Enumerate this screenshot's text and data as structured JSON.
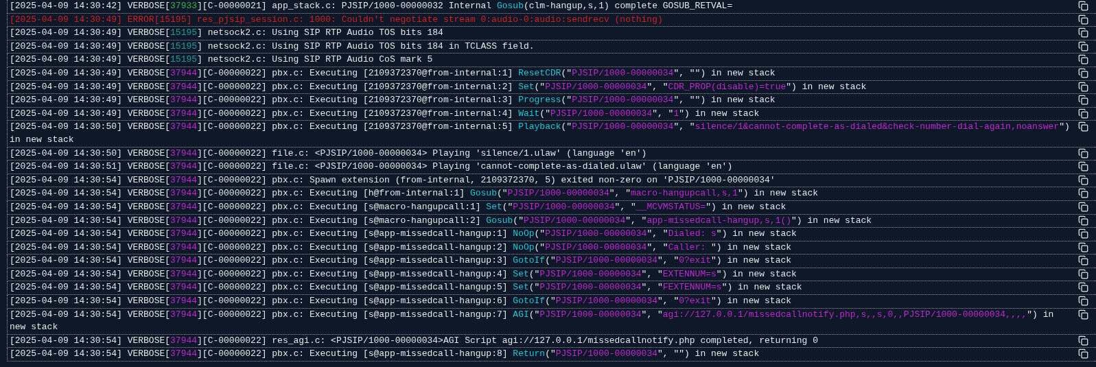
{
  "log_lines": [
    {
      "kind": "verbose",
      "parts": [
        {
          "kind": "text",
          "text": "[2025-04-09 14:30:42] VERBOSE["
        },
        {
          "kind": "pid",
          "text": "37933",
          "color": "#2fb344"
        },
        {
          "kind": "text",
          "text": "][C-00000021] app_stack.c: PJSIP/1000-00000032 Internal "
        },
        {
          "kind": "app",
          "text": "Gosub"
        },
        {
          "kind": "text",
          "text": "(clm-hangup,s,1) complete GOSUB_RETVAL="
        }
      ]
    },
    {
      "kind": "error",
      "parts": [
        {
          "kind": "text",
          "text": "[2025-04-09 14:30:49] ERROR[15195] res_pjsip_session.c: 1000: Couldn't negotiate stream 0:audio-0:audio:sendrecv (nothing)"
        }
      ]
    },
    {
      "kind": "verbose",
      "parts": [
        {
          "kind": "text",
          "text": "[2025-04-09 14:30:49] VERBOSE["
        },
        {
          "kind": "pid",
          "text": "15195",
          "color": "#17a09a"
        },
        {
          "kind": "text",
          "text": "] netsock2.c: Using SIP RTP Audio TOS bits 184"
        }
      ]
    },
    {
      "kind": "verbose",
      "parts": [
        {
          "kind": "text",
          "text": "[2025-04-09 14:30:49] VERBOSE["
        },
        {
          "kind": "pid",
          "text": "15195",
          "color": "#17a09a"
        },
        {
          "kind": "text",
          "text": "] netsock2.c: Using SIP RTP Audio TOS bits 184 in TCLASS field."
        }
      ]
    },
    {
      "kind": "verbose",
      "parts": [
        {
          "kind": "text",
          "text": "[2025-04-09 14:30:49] VERBOSE["
        },
        {
          "kind": "pid",
          "text": "15195",
          "color": "#17a09a"
        },
        {
          "kind": "text",
          "text": "] netsock2.c: Using SIP RTP Audio CoS mark 5"
        }
      ]
    },
    {
      "kind": "verbose",
      "parts": [
        {
          "kind": "text",
          "text": "[2025-04-09 14:30:49] VERBOSE["
        },
        {
          "kind": "pid",
          "text": "37944",
          "color": "#c026d3"
        },
        {
          "kind": "text",
          "text": "][C-00000022] pbx.c: Executing [2109372370@from-internal:1] "
        },
        {
          "kind": "app",
          "text": "ResetCDR"
        },
        {
          "kind": "text",
          "text": "(\""
        },
        {
          "kind": "arg",
          "text": "PJSIP/1000-00000034"
        },
        {
          "kind": "text",
          "text": "\", \"\") in new stack"
        }
      ]
    },
    {
      "kind": "verbose",
      "parts": [
        {
          "kind": "text",
          "text": "[2025-04-09 14:30:49] VERBOSE["
        },
        {
          "kind": "pid",
          "text": "37944",
          "color": "#c026d3"
        },
        {
          "kind": "text",
          "text": "][C-00000022] pbx.c: Executing [2109372370@from-internal:2] "
        },
        {
          "kind": "app",
          "text": "Set"
        },
        {
          "kind": "text",
          "text": "(\""
        },
        {
          "kind": "arg",
          "text": "PJSIP/1000-00000034"
        },
        {
          "kind": "text",
          "text": "\", \""
        },
        {
          "kind": "arg",
          "text": "CDR_PROP(disable)=true"
        },
        {
          "kind": "text",
          "text": "\") in new stack"
        }
      ]
    },
    {
      "kind": "verbose",
      "parts": [
        {
          "kind": "text",
          "text": "[2025-04-09 14:30:49] VERBOSE["
        },
        {
          "kind": "pid",
          "text": "37944",
          "color": "#c026d3"
        },
        {
          "kind": "text",
          "text": "][C-00000022] pbx.c: Executing [2109372370@from-internal:3] "
        },
        {
          "kind": "app",
          "text": "Progress"
        },
        {
          "kind": "text",
          "text": "(\""
        },
        {
          "kind": "arg",
          "text": "PJSIP/1000-00000034"
        },
        {
          "kind": "text",
          "text": "\", \"\") in new stack"
        }
      ]
    },
    {
      "kind": "verbose",
      "parts": [
        {
          "kind": "text",
          "text": "[2025-04-09 14:30:49] VERBOSE["
        },
        {
          "kind": "pid",
          "text": "37944",
          "color": "#c026d3"
        },
        {
          "kind": "text",
          "text": "][C-00000022] pbx.c: Executing [2109372370@from-internal:4] "
        },
        {
          "kind": "app",
          "text": "Wait"
        },
        {
          "kind": "text",
          "text": "(\""
        },
        {
          "kind": "arg",
          "text": "PJSIP/1000-00000034"
        },
        {
          "kind": "text",
          "text": "\", \""
        },
        {
          "kind": "arg",
          "text": "1"
        },
        {
          "kind": "text",
          "text": "\") in new stack"
        }
      ]
    },
    {
      "kind": "verbose",
      "parts": [
        {
          "kind": "text",
          "text": "[2025-04-09 14:30:50] VERBOSE["
        },
        {
          "kind": "pid",
          "text": "37944",
          "color": "#c026d3"
        },
        {
          "kind": "text",
          "text": "][C-00000022] pbx.c: Executing [2109372370@from-internal:5] "
        },
        {
          "kind": "app",
          "text": "Playback"
        },
        {
          "kind": "text",
          "text": "(\""
        },
        {
          "kind": "arg",
          "text": "PJSIP/1000-00000034"
        },
        {
          "kind": "text",
          "text": "\", \""
        },
        {
          "kind": "arg",
          "text": "silence/1&cannot-complete-as-dialed&check-number-dial-again,noanswer"
        },
        {
          "kind": "text",
          "text": "\") in new stack"
        }
      ]
    },
    {
      "kind": "verbose",
      "parts": [
        {
          "kind": "text",
          "text": "[2025-04-09 14:30:50] VERBOSE["
        },
        {
          "kind": "pid",
          "text": "37944",
          "color": "#c026d3"
        },
        {
          "kind": "text",
          "text": "][C-00000022] file.c: <PJSIP/1000-00000034> Playing 'silence/1.ulaw' (language 'en')"
        }
      ]
    },
    {
      "kind": "verbose",
      "parts": [
        {
          "kind": "text",
          "text": "[2025-04-09 14:30:51] VERBOSE["
        },
        {
          "kind": "pid",
          "text": "37944",
          "color": "#c026d3"
        },
        {
          "kind": "text",
          "text": "][C-00000022] file.c: <PJSIP/1000-00000034> Playing 'cannot-complete-as-dialed.ulaw' (language 'en')"
        }
      ]
    },
    {
      "kind": "verbose",
      "parts": [
        {
          "kind": "text",
          "text": "[2025-04-09 14:30:54] VERBOSE["
        },
        {
          "kind": "pid",
          "text": "37944",
          "color": "#c026d3"
        },
        {
          "kind": "text",
          "text": "][C-00000022] pbx.c: Spawn extension (from-internal, 2109372370, 5) exited non-zero on 'PJSIP/1000-00000034'"
        }
      ]
    },
    {
      "kind": "verbose",
      "parts": [
        {
          "kind": "text",
          "text": "[2025-04-09 14:30:54] VERBOSE["
        },
        {
          "kind": "pid",
          "text": "37944",
          "color": "#c026d3"
        },
        {
          "kind": "text",
          "text": "][C-00000022] pbx.c: Executing [h@from-internal:1] "
        },
        {
          "kind": "app",
          "text": "Gosub"
        },
        {
          "kind": "text",
          "text": "(\""
        },
        {
          "kind": "arg",
          "text": "PJSIP/1000-00000034"
        },
        {
          "kind": "text",
          "text": "\", \""
        },
        {
          "kind": "arg",
          "text": "macro-hangupcall,s,1"
        },
        {
          "kind": "text",
          "text": "\") in new stack"
        }
      ]
    },
    {
      "kind": "verbose",
      "parts": [
        {
          "kind": "text",
          "text": "[2025-04-09 14:30:54] VERBOSE["
        },
        {
          "kind": "pid",
          "text": "37944",
          "color": "#c026d3"
        },
        {
          "kind": "text",
          "text": "][C-00000022] pbx.c: Executing [s@macro-hangupcall:1] "
        },
        {
          "kind": "app",
          "text": "Set"
        },
        {
          "kind": "text",
          "text": "(\""
        },
        {
          "kind": "arg",
          "text": "PJSIP/1000-00000034"
        },
        {
          "kind": "text",
          "text": "\", \""
        },
        {
          "kind": "arg",
          "text": "__MCVMSTATUS="
        },
        {
          "kind": "text",
          "text": "\") in new stack"
        }
      ]
    },
    {
      "kind": "verbose",
      "parts": [
        {
          "kind": "text",
          "text": "[2025-04-09 14:30:54] VERBOSE["
        },
        {
          "kind": "pid",
          "text": "37944",
          "color": "#c026d3"
        },
        {
          "kind": "text",
          "text": "][C-00000022] pbx.c: Executing [s@macro-hangupcall:2] "
        },
        {
          "kind": "app",
          "text": "Gosub"
        },
        {
          "kind": "text",
          "text": "(\""
        },
        {
          "kind": "arg",
          "text": "PJSIP/1000-00000034"
        },
        {
          "kind": "text",
          "text": "\", \""
        },
        {
          "kind": "arg",
          "text": "app-missedcall-hangup,s,1()"
        },
        {
          "kind": "text",
          "text": "\") in new stack"
        }
      ]
    },
    {
      "kind": "verbose",
      "parts": [
        {
          "kind": "text",
          "text": "[2025-04-09 14:30:54] VERBOSE["
        },
        {
          "kind": "pid",
          "text": "37944",
          "color": "#c026d3"
        },
        {
          "kind": "text",
          "text": "][C-00000022] pbx.c: Executing [s@app-missedcall-hangup:1] "
        },
        {
          "kind": "app",
          "text": "NoOp"
        },
        {
          "kind": "text",
          "text": "(\""
        },
        {
          "kind": "arg",
          "text": "PJSIP/1000-00000034"
        },
        {
          "kind": "text",
          "text": "\", \""
        },
        {
          "kind": "arg",
          "text": "Dialed: s"
        },
        {
          "kind": "text",
          "text": "\") in new stack"
        }
      ]
    },
    {
      "kind": "verbose",
      "parts": [
        {
          "kind": "text",
          "text": "[2025-04-09 14:30:54] VERBOSE["
        },
        {
          "kind": "pid",
          "text": "37944",
          "color": "#c026d3"
        },
        {
          "kind": "text",
          "text": "][C-00000022] pbx.c: Executing [s@app-missedcall-hangup:2] "
        },
        {
          "kind": "app",
          "text": "NoOp"
        },
        {
          "kind": "text",
          "text": "(\""
        },
        {
          "kind": "arg",
          "text": "PJSIP/1000-00000034"
        },
        {
          "kind": "text",
          "text": "\", \""
        },
        {
          "kind": "arg",
          "text": "Caller: "
        },
        {
          "kind": "text",
          "text": "\") in new stack"
        }
      ]
    },
    {
      "kind": "verbose",
      "parts": [
        {
          "kind": "text",
          "text": "[2025-04-09 14:30:54] VERBOSE["
        },
        {
          "kind": "pid",
          "text": "37944",
          "color": "#c026d3"
        },
        {
          "kind": "text",
          "text": "][C-00000022] pbx.c: Executing [s@app-missedcall-hangup:3] "
        },
        {
          "kind": "app",
          "text": "GotoIf"
        },
        {
          "kind": "text",
          "text": "(\""
        },
        {
          "kind": "arg",
          "text": "PJSIP/1000-00000034"
        },
        {
          "kind": "text",
          "text": "\", \""
        },
        {
          "kind": "arg",
          "text": "0?exit"
        },
        {
          "kind": "text",
          "text": "\") in new stack"
        }
      ]
    },
    {
      "kind": "verbose",
      "parts": [
        {
          "kind": "text",
          "text": "[2025-04-09 14:30:54] VERBOSE["
        },
        {
          "kind": "pid",
          "text": "37944",
          "color": "#c026d3"
        },
        {
          "kind": "text",
          "text": "][C-00000022] pbx.c: Executing [s@app-missedcall-hangup:4] "
        },
        {
          "kind": "app",
          "text": "Set"
        },
        {
          "kind": "text",
          "text": "(\""
        },
        {
          "kind": "arg",
          "text": "PJSIP/1000-00000034"
        },
        {
          "kind": "text",
          "text": "\", \""
        },
        {
          "kind": "arg",
          "text": "EXTENNUM=s"
        },
        {
          "kind": "text",
          "text": "\") in new stack"
        }
      ]
    },
    {
      "kind": "verbose",
      "parts": [
        {
          "kind": "text",
          "text": "[2025-04-09 14:30:54] VERBOSE["
        },
        {
          "kind": "pid",
          "text": "37944",
          "color": "#c026d3"
        },
        {
          "kind": "text",
          "text": "][C-00000022] pbx.c: Executing [s@app-missedcall-hangup:5] "
        },
        {
          "kind": "app",
          "text": "Set"
        },
        {
          "kind": "text",
          "text": "(\""
        },
        {
          "kind": "arg",
          "text": "PJSIP/1000-00000034"
        },
        {
          "kind": "text",
          "text": "\", \""
        },
        {
          "kind": "arg",
          "text": "FEXTENNUM=s"
        },
        {
          "kind": "text",
          "text": "\") in new stack"
        }
      ]
    },
    {
      "kind": "verbose",
      "parts": [
        {
          "kind": "text",
          "text": "[2025-04-09 14:30:54] VERBOSE["
        },
        {
          "kind": "pid",
          "text": "37944",
          "color": "#c026d3"
        },
        {
          "kind": "text",
          "text": "][C-00000022] pbx.c: Executing [s@app-missedcall-hangup:6] "
        },
        {
          "kind": "app",
          "text": "GotoIf"
        },
        {
          "kind": "text",
          "text": "(\""
        },
        {
          "kind": "arg",
          "text": "PJSIP/1000-00000034"
        },
        {
          "kind": "text",
          "text": "\", \""
        },
        {
          "kind": "arg",
          "text": "0?exit"
        },
        {
          "kind": "text",
          "text": "\") in new stack"
        }
      ]
    },
    {
      "kind": "verbose",
      "parts": [
        {
          "kind": "text",
          "text": "[2025-04-09 14:30:54] VERBOSE["
        },
        {
          "kind": "pid",
          "text": "37944",
          "color": "#c026d3"
        },
        {
          "kind": "text",
          "text": "][C-00000022] pbx.c: Executing [s@app-missedcall-hangup:7] "
        },
        {
          "kind": "app",
          "text": "AGI"
        },
        {
          "kind": "text",
          "text": "(\""
        },
        {
          "kind": "arg",
          "text": "PJSIP/1000-00000034"
        },
        {
          "kind": "text",
          "text": "\", \""
        },
        {
          "kind": "arg",
          "text": "agi://127.0.0.1/missedcallnotify.php,s,,s,0,,PJSIP/1000-00000034,,,,"
        },
        {
          "kind": "text",
          "text": "\") in new stack"
        }
      ]
    },
    {
      "kind": "verbose",
      "parts": [
        {
          "kind": "text",
          "text": "[2025-04-09 14:30:54] VERBOSE["
        },
        {
          "kind": "pid",
          "text": "37944",
          "color": "#c026d3"
        },
        {
          "kind": "text",
          "text": "][C-00000022] res_agi.c: <PJSIP/1000-00000034>AGI Script agi://127.0.0.1/missedcallnotify.php completed, returning 0"
        }
      ]
    },
    {
      "kind": "verbose",
      "parts": [
        {
          "kind": "text",
          "text": "[2025-04-09 14:30:54] VERBOSE["
        },
        {
          "kind": "pid",
          "text": "37944",
          "color": "#c026d3"
        },
        {
          "kind": "text",
          "text": "][C-00000022] pbx.c: Executing [s@app-missedcall-hangup:8] "
        },
        {
          "kind": "app",
          "text": "Return"
        },
        {
          "kind": "text",
          "text": "(\""
        },
        {
          "kind": "arg",
          "text": "PJSIP/1000-00000034"
        },
        {
          "kind": "text",
          "text": "\", \"\") in new stack"
        }
      ]
    }
  ]
}
